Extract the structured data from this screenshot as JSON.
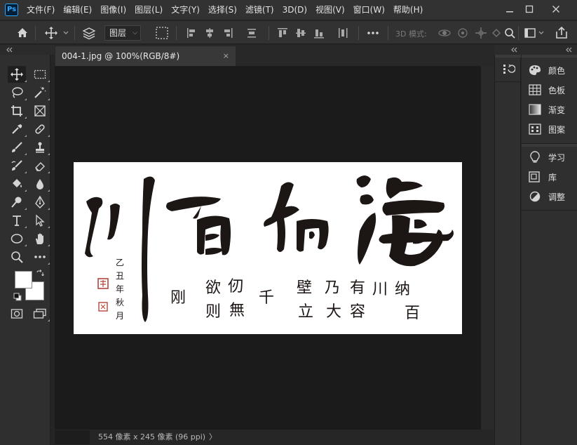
{
  "app": {
    "logo_text": "Ps"
  },
  "menu": {
    "items": [
      "文件(F)",
      "编辑(E)",
      "图像(I)",
      "图层(L)",
      "文字(Y)",
      "选择(S)",
      "滤镜(T)",
      "3D(D)",
      "视图(V)",
      "窗口(W)",
      "帮助(H)"
    ]
  },
  "options_bar": {
    "layer_select": "图层",
    "mode_3d_label": "3D 模式:"
  },
  "document": {
    "tab_title": "004-1.jpg @ 100%(RGB/8#)",
    "close_glyph": "×"
  },
  "status_bar": {
    "info": "554 像素 x 245 像素 (96 ppi)",
    "arrow": "〉"
  },
  "panels": [
    {
      "label": "颜色",
      "icon": "palette-icon"
    },
    {
      "label": "色板",
      "icon": "swatches-grid-icon"
    },
    {
      "label": "渐变",
      "icon": "gradient-icon"
    },
    {
      "label": "图案",
      "icon": "pattern-icon"
    },
    {
      "label": "学习",
      "icon": "lightbulb-icon"
    },
    {
      "label": "库",
      "icon": "libraries-icon"
    },
    {
      "label": "调整",
      "icon": "adjustments-icon"
    }
  ],
  "colors": {
    "foreground": "#ffffff",
    "background": "#ffffff",
    "ink": "#1c1614",
    "seal": "#b5443c"
  }
}
